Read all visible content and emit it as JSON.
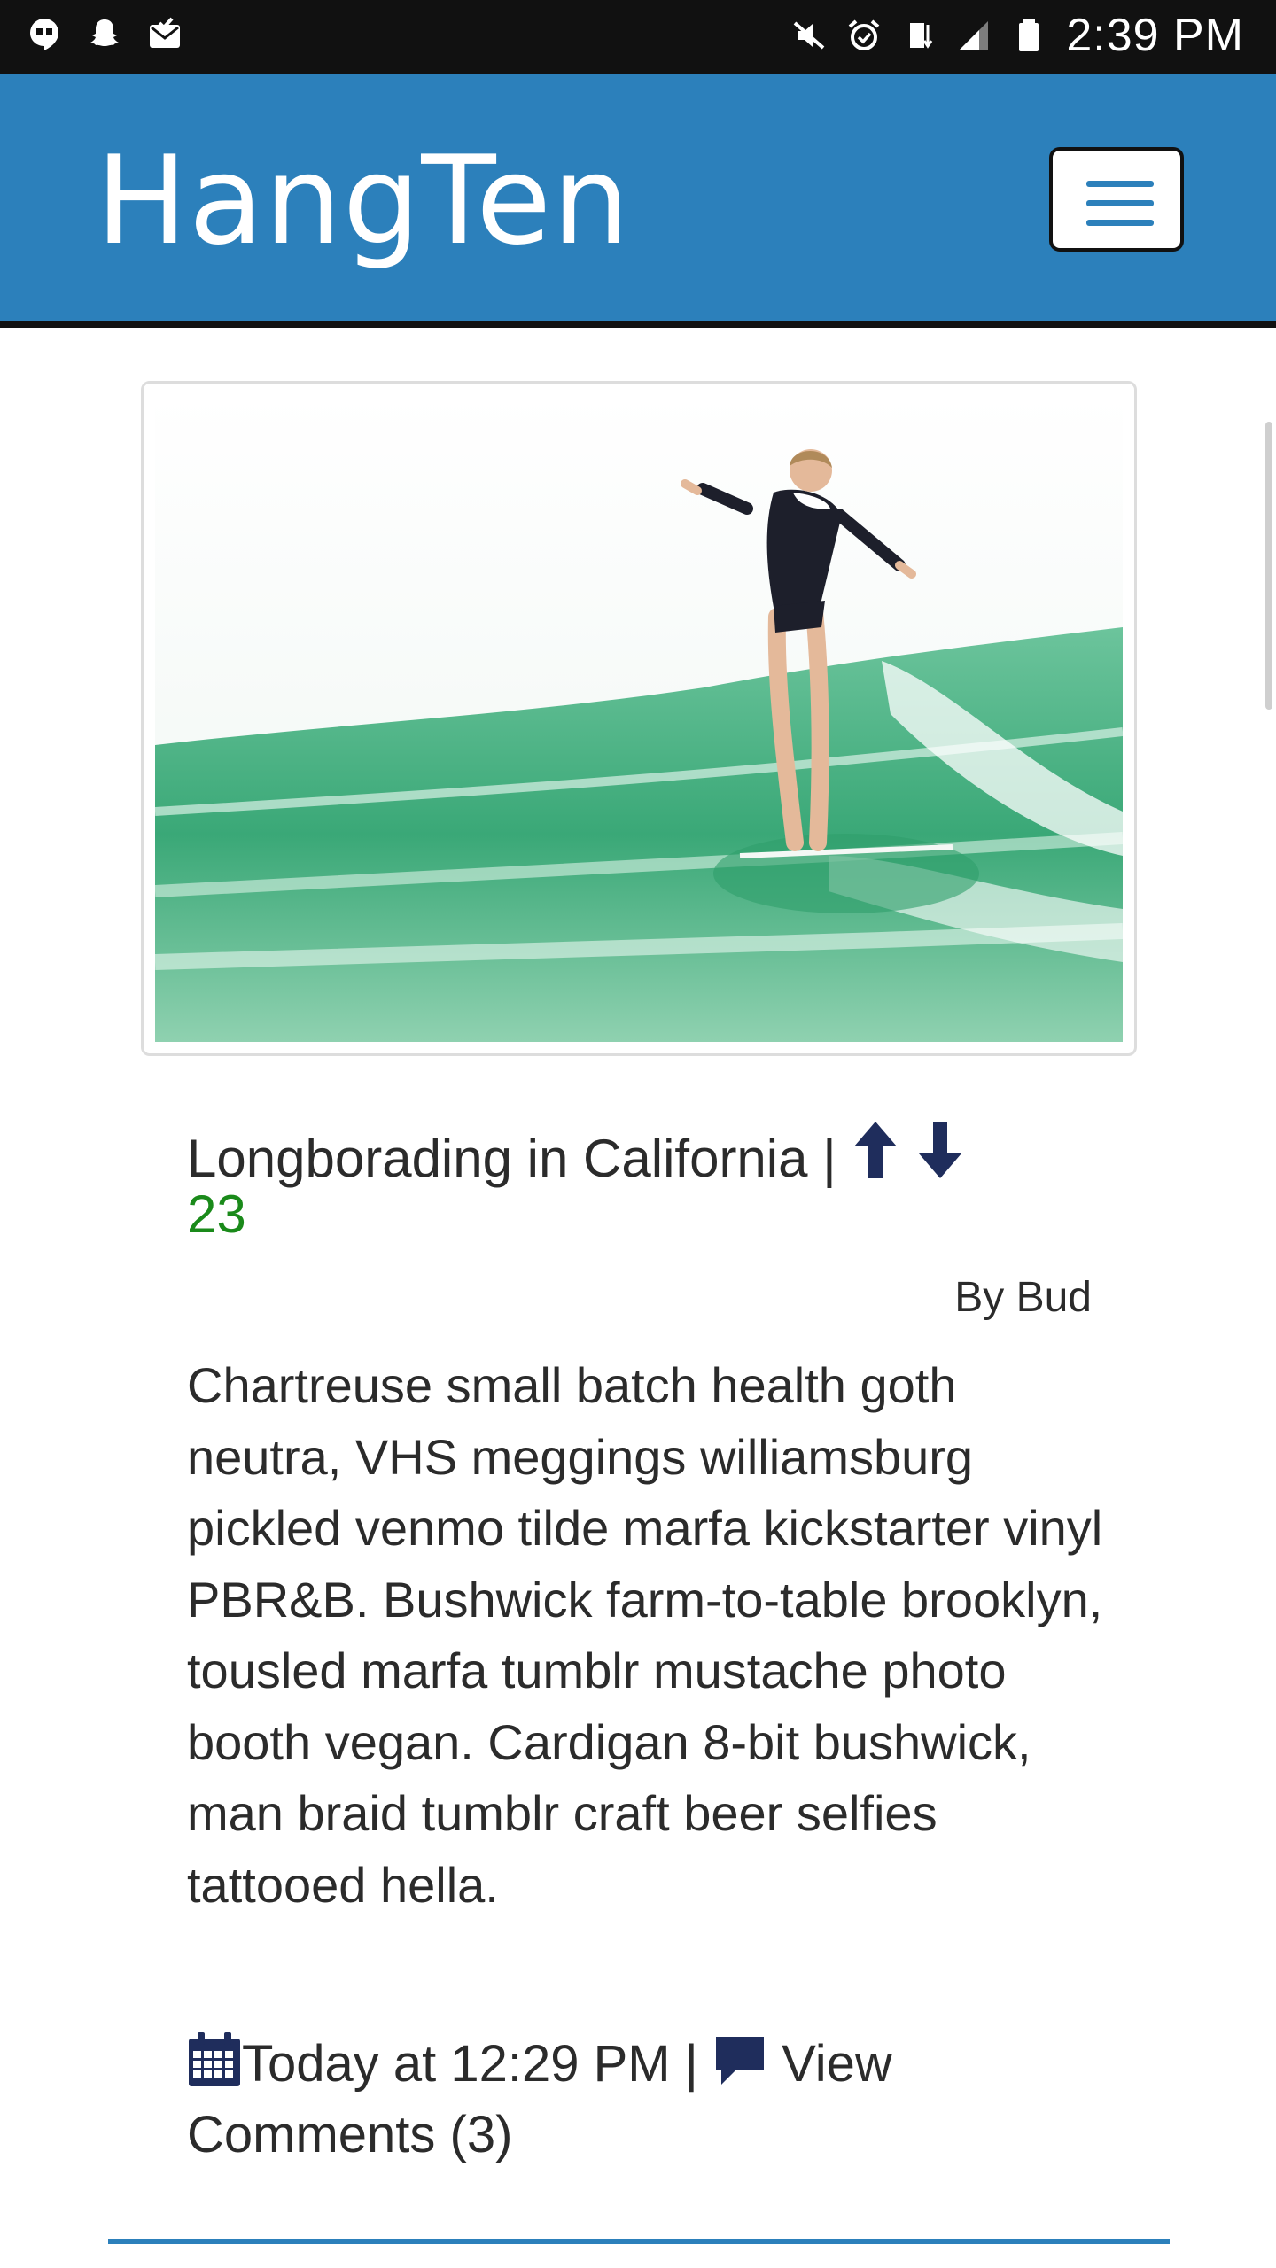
{
  "status_bar": {
    "time": "2:39 PM",
    "left_icons": [
      "hangouts-icon",
      "snapchat-icon",
      "mail-icon"
    ],
    "right_icons": [
      "mute-icon",
      "alarm-icon",
      "lte-icon",
      "signal-icon",
      "battery-icon"
    ]
  },
  "navbar": {
    "brand": "HangTen",
    "toggle_icon": "hamburger-menu-icon"
  },
  "post": {
    "image_alt": "surfer-longboarding-on-wave",
    "title": "Longborading in California",
    "title_separator": " | ",
    "score": "23",
    "author": "By Bud",
    "body": "Chartreuse small batch health goth neutra, VHS meggings williamsburg pickled venmo tilde marfa kickstarter vinyl PBR&B. Bushwick farm-to-table brooklyn, tousled marfa tumblr mustache photo booth vegan. Cardigan 8-bit bushwick, man braid tumblr craft beer selfies tattooed hella.",
    "timestamp": "Today at 12:29 PM",
    "meta_separator": " | ",
    "comments_label": "View Comments (3)"
  },
  "colors": {
    "brand_blue": "#2c80bb",
    "icon_navy": "#1f2d5c",
    "score_green": "#1a8a1a"
  }
}
